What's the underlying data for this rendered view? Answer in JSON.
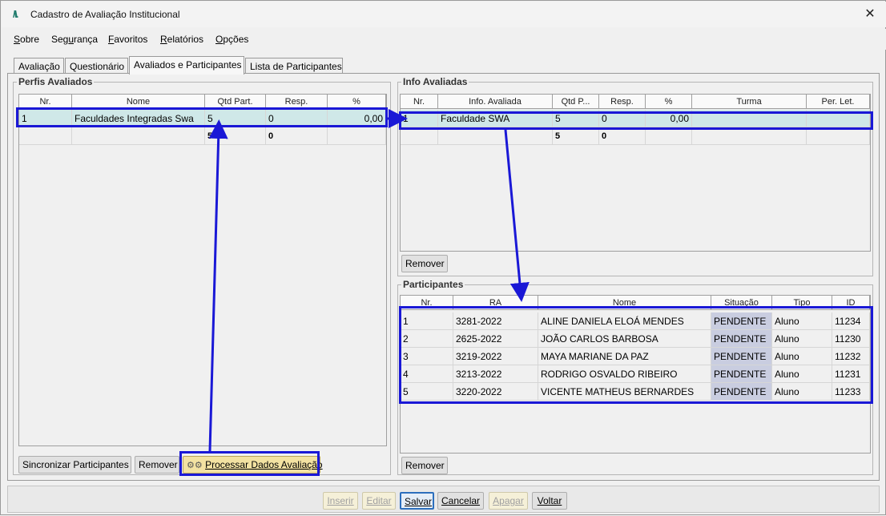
{
  "window": {
    "title": "Cadastro de Avaliação Institucional",
    "icon": "app-logo-icon",
    "close_glyph": "✕"
  },
  "menu": [
    {
      "pre": "",
      "u": "S",
      "post": "obre"
    },
    {
      "pre": "Seg",
      "u": "u",
      "post": "rança"
    },
    {
      "pre": "",
      "u": "F",
      "post": "avoritos"
    },
    {
      "pre": "",
      "u": "R",
      "post": "elatórios"
    },
    {
      "pre": "",
      "u": "O",
      "post": "pções"
    }
  ],
  "tabs": [
    "Avaliação",
    "Questionário",
    "Avaliados e Participantes",
    "Lista de Participantes"
  ],
  "perfis": {
    "title": "Perfis Avaliados",
    "headers": [
      "Nr.",
      "Nome",
      "Qtd Part.",
      "Resp.",
      "%"
    ],
    "rows": [
      [
        "1",
        "Faculdades Integradas Swa",
        "5",
        "0",
        "0,00"
      ]
    ],
    "totals": [
      "",
      "",
      "5",
      "0",
      ""
    ],
    "buttons": {
      "sync": "Sincronizar Participantes",
      "remove": "Remover",
      "process": "Processar Dados Avaliação"
    }
  },
  "info": {
    "title": "Info Avaliadas",
    "headers": [
      "Nr.",
      "Info. Avaliada",
      "Qtd P...",
      "Resp.",
      "%",
      "Turma",
      "Per. Let."
    ],
    "rows": [
      [
        "1",
        "Faculdade SWA",
        "5",
        "0",
        "0,00",
        "",
        ""
      ]
    ],
    "totals": [
      "",
      "",
      "5",
      "0",
      "",
      "",
      ""
    ],
    "remove": "Remover"
  },
  "participantes": {
    "title": "Participantes",
    "headers": [
      "Nr.",
      "RA",
      "Nome",
      "Situação",
      "Tipo",
      "ID"
    ],
    "rows": [
      [
        "1",
        "3281-2022",
        "ALINE DANIELA ELOÁ MENDES",
        "PENDENTE",
        "Aluno",
        "11234"
      ],
      [
        "2",
        "2625-2022",
        "JOÃO CARLOS BARBOSA",
        "PENDENTE",
        "Aluno",
        "11230"
      ],
      [
        "3",
        "3219-2022",
        "MAYA MARIANE DA PAZ",
        "PENDENTE",
        "Aluno",
        "11232"
      ],
      [
        "4",
        "3213-2022",
        "RODRIGO OSVALDO RIBEIRO",
        "PENDENTE",
        "Aluno",
        "11231"
      ],
      [
        "5",
        "3220-2022",
        "VICENTE MATHEUS BERNARDES",
        "PENDENTE",
        "Aluno",
        "11233"
      ]
    ],
    "remove": "Remover"
  },
  "bottom": {
    "inserir": "Inserir",
    "editar": "Editar",
    "salvar": "Salvar",
    "cancelar": "Cancelar",
    "apagar": "Apagar",
    "voltar": "Voltar"
  },
  "colors": {
    "highlight": "#1a18d6",
    "selected_row": "#cfe8e8",
    "status_cell": "#c9cde0",
    "process_button": "#f3e2a2"
  }
}
